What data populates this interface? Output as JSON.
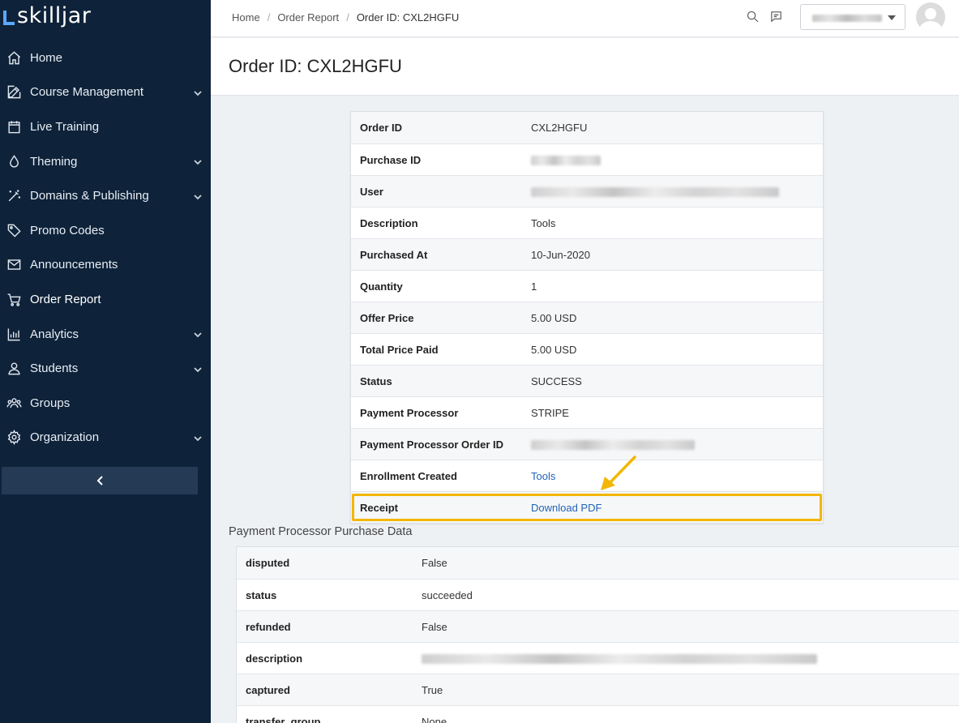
{
  "brand": {
    "name": "skilljar"
  },
  "sidebar": {
    "items": [
      {
        "label": "Home",
        "icon": "home-icon",
        "expandable": false
      },
      {
        "label": "Course Management",
        "icon": "edit-icon",
        "expandable": true
      },
      {
        "label": "Live Training",
        "icon": "calendar-icon",
        "expandable": false
      },
      {
        "label": "Theming",
        "icon": "droplet-icon",
        "expandable": true
      },
      {
        "label": "Domains & Publishing",
        "icon": "magic-wand-icon",
        "expandable": true
      },
      {
        "label": "Promo Codes",
        "icon": "tag-icon",
        "expandable": false
      },
      {
        "label": "Announcements",
        "icon": "envelope-icon",
        "expandable": false
      },
      {
        "label": "Order Report",
        "icon": "cart-icon",
        "expandable": false,
        "active": true
      },
      {
        "label": "Analytics",
        "icon": "bar-chart-icon",
        "expandable": true
      },
      {
        "label": "Students",
        "icon": "user-icon",
        "expandable": true
      },
      {
        "label": "Groups",
        "icon": "users-icon",
        "expandable": false
      },
      {
        "label": "Organization",
        "icon": "gear-icon",
        "expandable": true
      }
    ]
  },
  "breadcrumb": {
    "home": "Home",
    "report": "Order Report",
    "current": "Order ID: CXL2HGFU"
  },
  "page": {
    "title": "Order ID: CXL2HGFU"
  },
  "order": {
    "order_id_label": "Order ID",
    "order_id": "CXL2HGFU",
    "purchase_id_label": "Purchase ID",
    "user_label": "User",
    "description_label": "Description",
    "description": "Tools",
    "purchased_at_label": "Purchased At",
    "purchased_at": "10-Jun-2020",
    "quantity_label": "Quantity",
    "quantity": "1",
    "offer_price_label": "Offer Price",
    "offer_price": "5.00 USD",
    "total_price_label": "Total Price Paid",
    "total_price": "5.00 USD",
    "status_label": "Status",
    "status": "SUCCESS",
    "processor_label": "Payment Processor",
    "processor": "STRIPE",
    "processor_order_id_label": "Payment Processor Order ID",
    "enrollment_label": "Enrollment Created",
    "enrollment": "Tools",
    "receipt_label": "Receipt",
    "receipt_link": "Download PDF"
  },
  "processor_data": {
    "title": "Payment Processor Purchase Data",
    "disputed_label": "disputed",
    "disputed": "False",
    "status_label": "status",
    "status": "succeeded",
    "refunded_label": "refunded",
    "refunded": "False",
    "description_label": "description",
    "captured_label": "captured",
    "captured": "True",
    "transfer_group_label": "transfer_group",
    "transfer_group": "None"
  },
  "colors": {
    "sidebar_bg": "#0e2239",
    "highlight": "#f2b705",
    "link": "#1f64b4"
  }
}
